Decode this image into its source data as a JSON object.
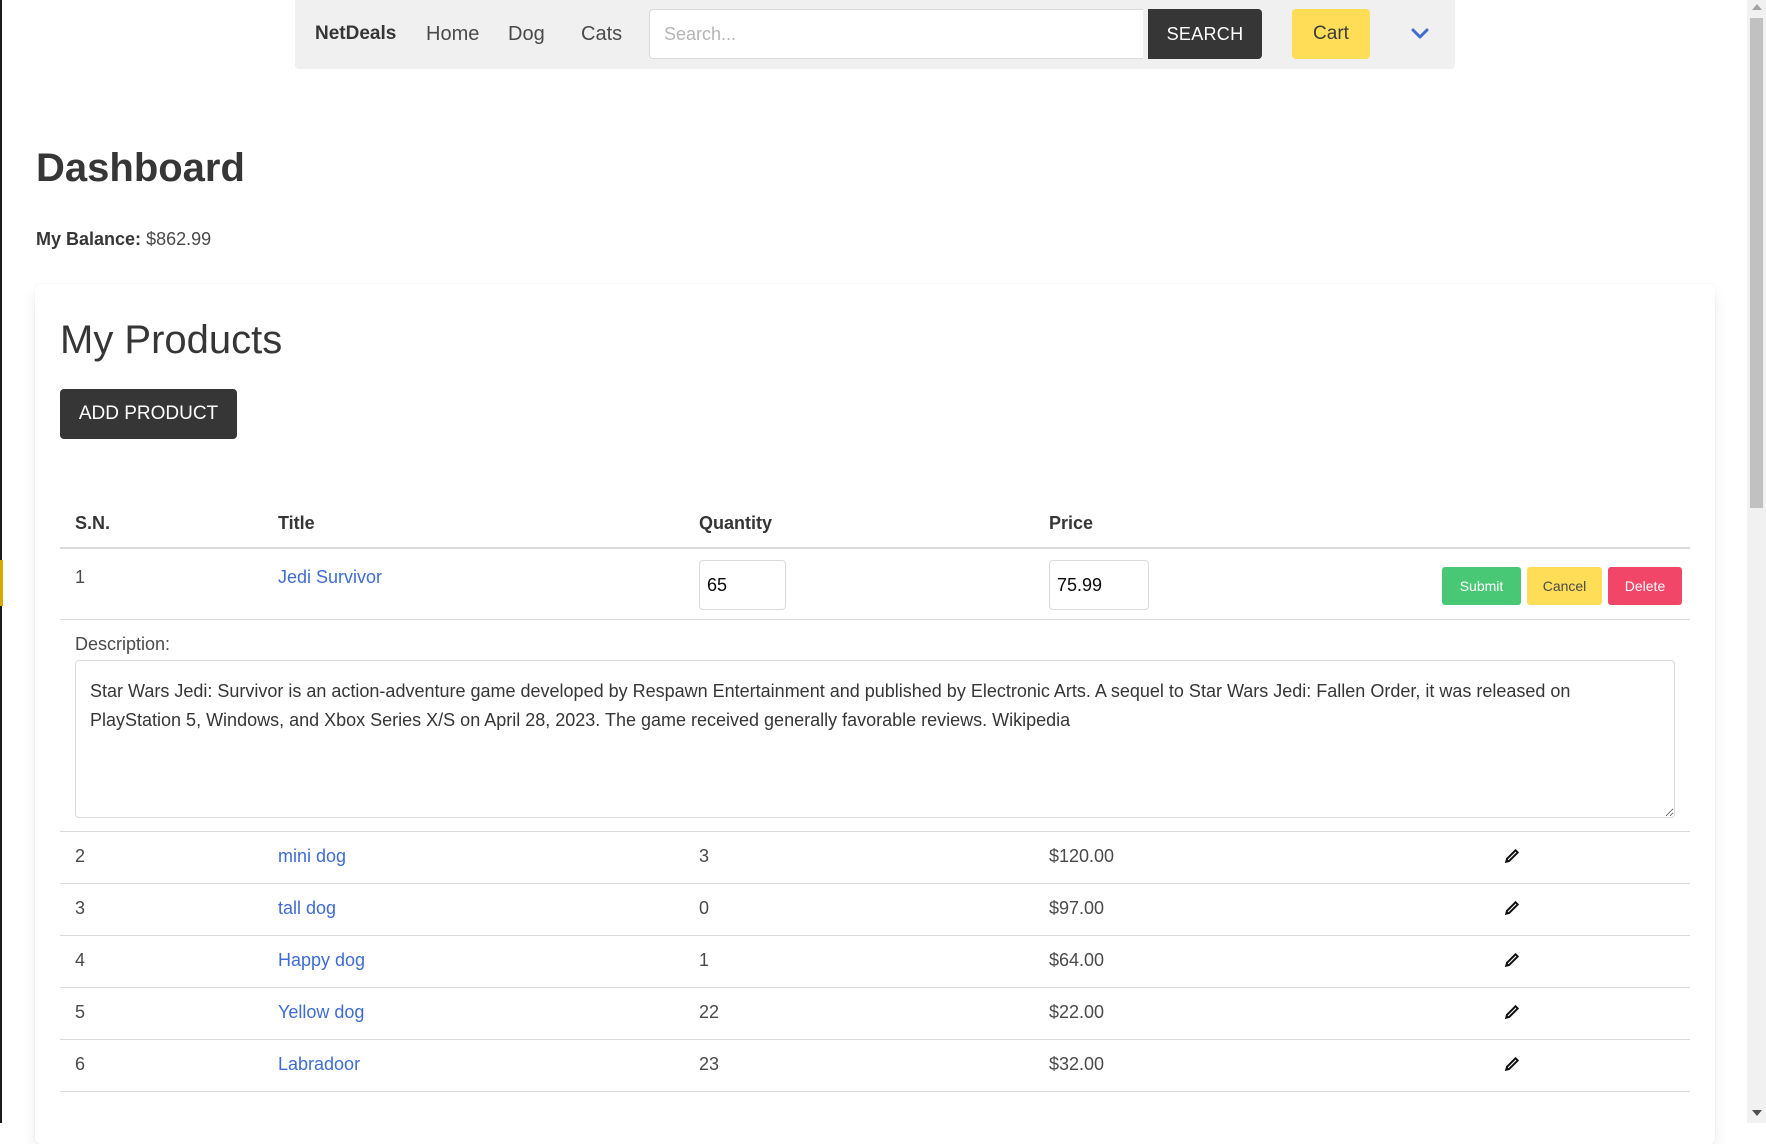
{
  "nav": {
    "brand": "NetDeals",
    "links": [
      "Home",
      "Dog",
      "Cats"
    ],
    "search_placeholder": "Search...",
    "search_label": "SEARCH",
    "cart_label": "Cart",
    "dropdown_icon": "chevron-down-icon"
  },
  "page": {
    "title": "Dashboard",
    "balance_label": "My Balance:",
    "balance_value": "$862.99"
  },
  "products": {
    "title": "My Products",
    "add_label": "ADD PRODUCT",
    "columns": [
      "S.N.",
      "Title",
      "Quantity",
      "Price"
    ],
    "editing": {
      "sn": "1",
      "title": "Jedi Survivor",
      "quantity": "65",
      "price": "75.99",
      "submit_label": "Submit",
      "cancel_label": "Cancel",
      "delete_label": "Delete",
      "description_label": "Description:",
      "description": "Star Wars Jedi: Survivor is an action-adventure game developed by Respawn Entertainment and published by Electronic Arts. A sequel to Star Wars Jedi: Fallen Order, it was released on PlayStation 5, Windows, and Xbox Series X/S on April 28, 2023. The game received generally favorable reviews. Wikipedia"
    },
    "rows": [
      {
        "sn": "2",
        "title": "mini dog",
        "quantity": "3",
        "price": "$120.00"
      },
      {
        "sn": "3",
        "title": "tall dog",
        "quantity": "0",
        "price": "$97.00"
      },
      {
        "sn": "4",
        "title": "Happy dog",
        "quantity": "1",
        "price": "$64.00"
      },
      {
        "sn": "5",
        "title": "Yellow dog",
        "quantity": "22",
        "price": "$22.00"
      },
      {
        "sn": "6",
        "title": "Labradoor",
        "quantity": "23",
        "price": "$32.00"
      }
    ],
    "edit_icon": "pencil-icon"
  },
  "colors": {
    "dark": "#363636",
    "link": "#3e6cd3",
    "success": "#48c774",
    "warning": "#ffdd57",
    "danger": "#f14668"
  }
}
